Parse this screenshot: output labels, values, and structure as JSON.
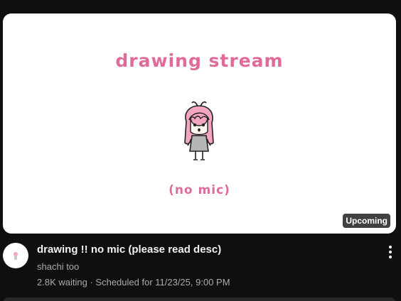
{
  "thumbnail": {
    "title_text": "drawing stream",
    "subtitle_text": "(no mic)",
    "badge": "Upcoming",
    "accent_color": "#e06a9a"
  },
  "video": {
    "title": "drawing !! no mic (please read desc)",
    "channel": "shachi too",
    "waiting": "2.8K waiting",
    "separator": "·",
    "scheduled": "Scheduled for 11/23/25, 9:00 PM"
  },
  "icons": {
    "menu": "more-vert-icon",
    "avatar": "channel-avatar"
  }
}
